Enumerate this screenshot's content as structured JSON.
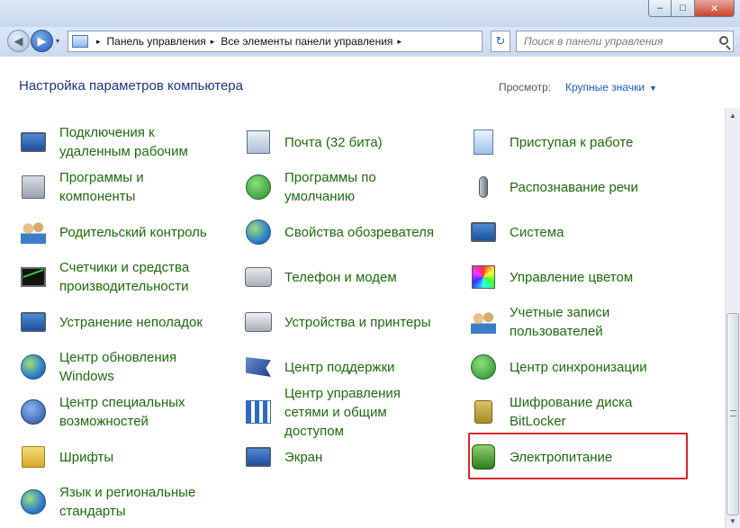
{
  "window": {
    "caption_min": "–",
    "caption_max": "□",
    "caption_close": "✕"
  },
  "nav": {
    "back_icon": "◀",
    "forward_icon": "▶",
    "dropdown_icon": "▾",
    "breadcrumbs": [
      "Панель управления",
      "Все элементы панели управления"
    ],
    "crumb_separator": "▸",
    "refresh_icon": "↻",
    "search_placeholder": "Поиск в панели управления"
  },
  "header": {
    "title": "Настройка параметров компьютера",
    "view_label": "Просмотр:",
    "view_value": "Крупные значки",
    "view_caret": "▼"
  },
  "items": {
    "col1": [
      {
        "label": "Подключения к удаленным рабочим",
        "icon": "remote-desktop-icon"
      },
      {
        "label": "Программы и компоненты",
        "icon": "programs-features-icon"
      },
      {
        "label": "Родительский контроль",
        "icon": "parental-controls-icon"
      },
      {
        "label": "Счетчики и средства производительности",
        "icon": "performance-icon"
      },
      {
        "label": "Устранение неполадок",
        "icon": "troubleshooting-icon"
      },
      {
        "label": "Центр обновления Windows",
        "icon": "windows-update-icon"
      },
      {
        "label": "Центр специальных возможностей",
        "icon": "ease-of-access-icon"
      },
      {
        "label": "Шрифты",
        "icon": "fonts-icon"
      },
      {
        "label": "Язык и региональные стандарты",
        "icon": "region-language-icon"
      }
    ],
    "col2": [
      {
        "label": "Почта (32 бита)",
        "icon": "mail-icon"
      },
      {
        "label": "Программы по умолчанию",
        "icon": "default-programs-icon"
      },
      {
        "label": "Свойства обозревателя",
        "icon": "internet-options-icon"
      },
      {
        "label": "Телефон и модем",
        "icon": "phone-modem-icon"
      },
      {
        "label": "Устройства и принтеры",
        "icon": "devices-printers-icon"
      },
      {
        "label": "Центр поддержки",
        "icon": "action-center-icon"
      },
      {
        "label": "Центр управления сетями и общим доступом",
        "icon": "network-center-icon"
      },
      {
        "label": "Экран",
        "icon": "display-icon"
      }
    ],
    "col3": [
      {
        "label": "Приступая к работе",
        "icon": "getting-started-icon"
      },
      {
        "label": "Распознавание речи",
        "icon": "speech-recognition-icon"
      },
      {
        "label": "Система",
        "icon": "system-icon"
      },
      {
        "label": "Управление цветом",
        "icon": "color-management-icon"
      },
      {
        "label": "Учетные записи пользователей",
        "icon": "user-accounts-icon"
      },
      {
        "label": "Центр синхронизации",
        "icon": "sync-center-icon"
      },
      {
        "label": "Шифрование диска BitLocker",
        "icon": "bitlocker-icon"
      },
      {
        "label": "Электропитание",
        "icon": "power-options-icon"
      }
    ]
  },
  "scrollbar": {
    "up_icon": "▲",
    "down_icon": "▼"
  },
  "colors": {
    "link_green": "#1d6b0d",
    "title_blue": "#1e3287",
    "highlight_red": "#e0202a"
  }
}
